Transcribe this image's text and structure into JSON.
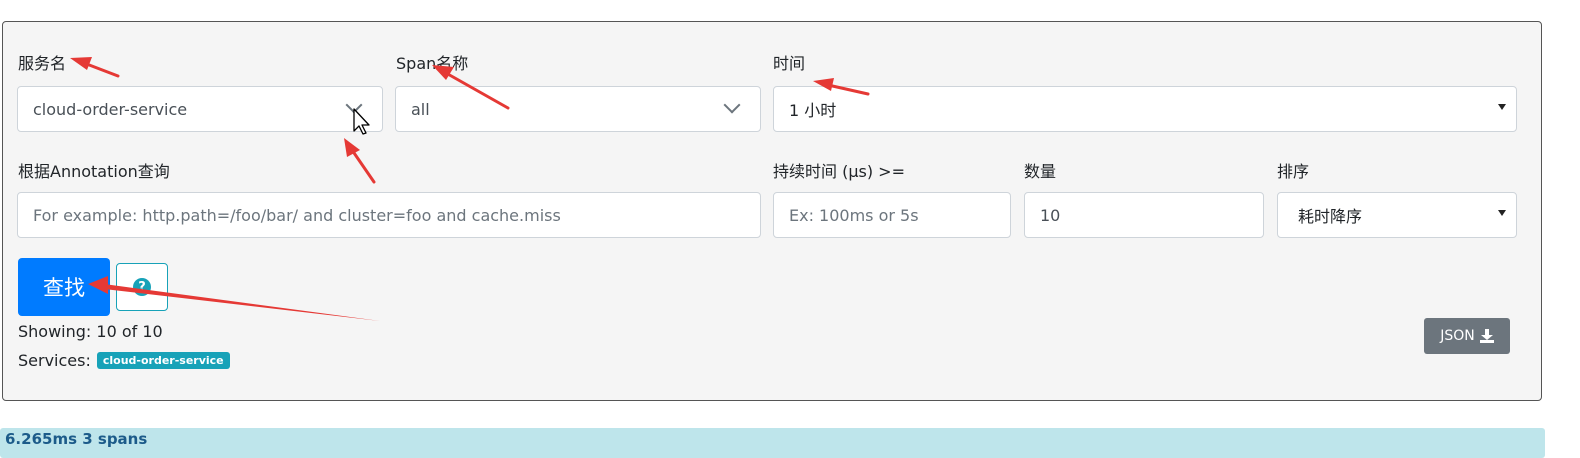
{
  "form": {
    "service_label": "服务名",
    "service_value": "cloud-order-service",
    "span_label": "Span名称",
    "span_value": "all",
    "time_label": "时间",
    "time_value": "1 小时",
    "annotation_label": "根据Annotation查询",
    "annotation_placeholder": "For example: http.path=/foo/bar/ and cluster=foo and cache.miss",
    "duration_label": "持续时间 (μs) >=",
    "duration_placeholder": "Ex: 100ms or 5s",
    "limit_label": "数量",
    "limit_value": "10",
    "sort_label": "排序",
    "sort_value": "耗时降序"
  },
  "actions": {
    "search_label": "查找",
    "help_icon_glyph": "?",
    "json_label": "JSON"
  },
  "summary": {
    "showing": "Showing: 10 of 10",
    "services_label": "Services:",
    "service_badge": "cloud-order-service"
  },
  "results": {
    "first_trace": "6.265ms    3 spans"
  },
  "icons": {
    "service_select": "chevron-down-icon",
    "span_select": "chevron-down-icon",
    "time_select": "caret-down-icon",
    "sort_select": "caret-down-icon",
    "help": "question-circle-icon",
    "json": "download-icon",
    "cursor": "mouse-cursor-icon"
  },
  "colors": {
    "primary": "#007bff",
    "info": "#17a2b8",
    "secondary": "#6c757d",
    "annotation_arrow": "#e53935",
    "result_bar": "#bee5eb"
  }
}
